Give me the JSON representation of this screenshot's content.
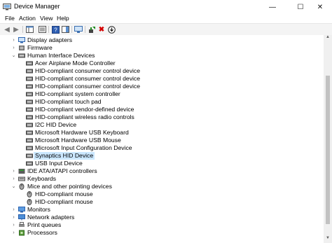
{
  "window": {
    "title": "Device Manager",
    "minimize": "—",
    "maximize": "☐",
    "close": "✕"
  },
  "menu": [
    "File",
    "Action",
    "View",
    "Help"
  ],
  "tree": [
    {
      "label": "Display adapters",
      "level": 1,
      "chev": "›",
      "icon": "display-adapter-icon",
      "selected": false
    },
    {
      "label": "Firmware",
      "level": 1,
      "chev": "›",
      "icon": "firmware-icon",
      "selected": false
    },
    {
      "label": "Human Interface Devices",
      "level": 1,
      "chev": "⌄",
      "icon": "hid-icon",
      "selected": false
    },
    {
      "label": "Acer Airplane Mode Controller",
      "level": 2,
      "chev": "",
      "icon": "hid-device-icon",
      "selected": false
    },
    {
      "label": "HID-compliant consumer control device",
      "level": 2,
      "chev": "",
      "icon": "hid-device-icon",
      "selected": false
    },
    {
      "label": "HID-compliant consumer control device",
      "level": 2,
      "chev": "",
      "icon": "hid-device-icon",
      "selected": false
    },
    {
      "label": "HID-compliant consumer control device",
      "level": 2,
      "chev": "",
      "icon": "hid-device-icon",
      "selected": false
    },
    {
      "label": "HID-compliant system controller",
      "level": 2,
      "chev": "",
      "icon": "hid-device-icon",
      "selected": false
    },
    {
      "label": "HID-compliant touch pad",
      "level": 2,
      "chev": "",
      "icon": "hid-device-icon",
      "selected": false
    },
    {
      "label": "HID-compliant vendor-defined device",
      "level": 2,
      "chev": "",
      "icon": "hid-device-icon",
      "selected": false
    },
    {
      "label": "HID-compliant wireless radio controls",
      "level": 2,
      "chev": "",
      "icon": "hid-device-icon",
      "selected": false
    },
    {
      "label": "I2C HID Device",
      "level": 2,
      "chev": "",
      "icon": "hid-device-icon",
      "selected": false
    },
    {
      "label": "Microsoft Hardware USB Keyboard",
      "level": 2,
      "chev": "",
      "icon": "hid-device-icon",
      "selected": false
    },
    {
      "label": "Microsoft Hardware USB Mouse",
      "level": 2,
      "chev": "",
      "icon": "hid-device-icon",
      "selected": false
    },
    {
      "label": "Microsoft Input Configuration Device",
      "level": 2,
      "chev": "",
      "icon": "hid-device-icon",
      "selected": false
    },
    {
      "label": "Synaptics HID Device",
      "level": 2,
      "chev": "",
      "icon": "hid-device-icon",
      "selected": true
    },
    {
      "label": "USB Input Device",
      "level": 2,
      "chev": "",
      "icon": "hid-device-icon",
      "selected": false
    },
    {
      "label": "IDE ATA/ATAPI controllers",
      "level": 1,
      "chev": "›",
      "icon": "ide-controller-icon",
      "selected": false
    },
    {
      "label": "Keyboards",
      "level": 1,
      "chev": "›",
      "icon": "keyboard-icon",
      "selected": false
    },
    {
      "label": "Mice and other pointing devices",
      "level": 1,
      "chev": "⌄",
      "icon": "mouse-icon",
      "selected": false
    },
    {
      "label": "HID-compliant mouse",
      "level": 2,
      "chev": "",
      "icon": "mouse-icon",
      "selected": false
    },
    {
      "label": "HID-compliant mouse",
      "level": 2,
      "chev": "",
      "icon": "mouse-icon",
      "selected": false
    },
    {
      "label": "Monitors",
      "level": 1,
      "chev": "›",
      "icon": "monitor-icon",
      "selected": false
    },
    {
      "label": "Network adapters",
      "level": 1,
      "chev": "›",
      "icon": "network-adapter-icon",
      "selected": false
    },
    {
      "label": "Print queues",
      "level": 1,
      "chev": "›",
      "icon": "printer-icon",
      "selected": false
    },
    {
      "label": "Processors",
      "level": 1,
      "chev": "›",
      "icon": "processor-icon",
      "selected": false
    }
  ],
  "colors": {
    "selection": "#cce8ff",
    "remove_red": "#d40000",
    "enable_green": "#1a8a1a"
  }
}
